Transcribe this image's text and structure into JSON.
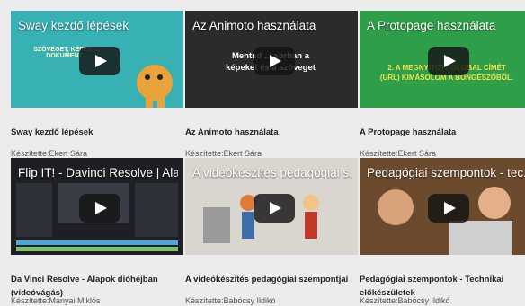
{
  "videos": [
    {
      "thumb_title": "Sway kezdő lépések",
      "overlay": "SZÖVEGET, KÉPET, ... DOKUMENT...",
      "title": "Sway kezdő lépések",
      "author": "Készítette:Ekert Sára",
      "colors": {
        "bg": "#37b1b4",
        "accent": "#e8a33b"
      }
    },
    {
      "thumb_title": "Az Animoto használata",
      "overlay": "Mentsd ... sorban a képeket és a szöveget",
      "title": "Az Animoto használata",
      "author": "Készítette:Ekert Sára",
      "colors": {
        "bg": "#2b2b2b",
        "accent": "#ffffff"
      }
    },
    {
      "thumb_title": "A Protopage használata",
      "overlay": "2. A MEGNYITOTT GLOBAL CÍMÉT (URL) KIMÁSOLOM A BÖNGÉSZŐBŐL.",
      "title": "A Protopage használata",
      "author": "Készítette:Ekert Sára",
      "colors": {
        "bg": "#2f9e49",
        "accent": "#f3e24a"
      }
    },
    {
      "thumb_title": "Flip IT! - Davinci Resolve | Ala...",
      "overlay": "",
      "title": "Da Vinci Resolve - Alapok dióhéjban (videóvágás)",
      "author": "Készítette:Mányai Miklós",
      "colors": {
        "bg": "#1e1f24",
        "accent": "#4aa6d6"
      }
    },
    {
      "thumb_title": "A videókészítés pedagógiai s...",
      "overlay": "",
      "title": "A videókészítés pedagógiai szempontjai",
      "author": "Készítette:Babócsy Ildikó",
      "colors": {
        "bg": "#d9d6d0",
        "accent": "#e07b3a"
      }
    },
    {
      "thumb_title": "Pedagógiai szempontok - tec...",
      "overlay": "",
      "title": "Pedagógiai szempontok - Technikai előkészületek",
      "author": "Készítette:Babócsy Ildikó",
      "colors": {
        "bg": "#6b4a2e",
        "accent": "#c98a4a"
      }
    }
  ]
}
